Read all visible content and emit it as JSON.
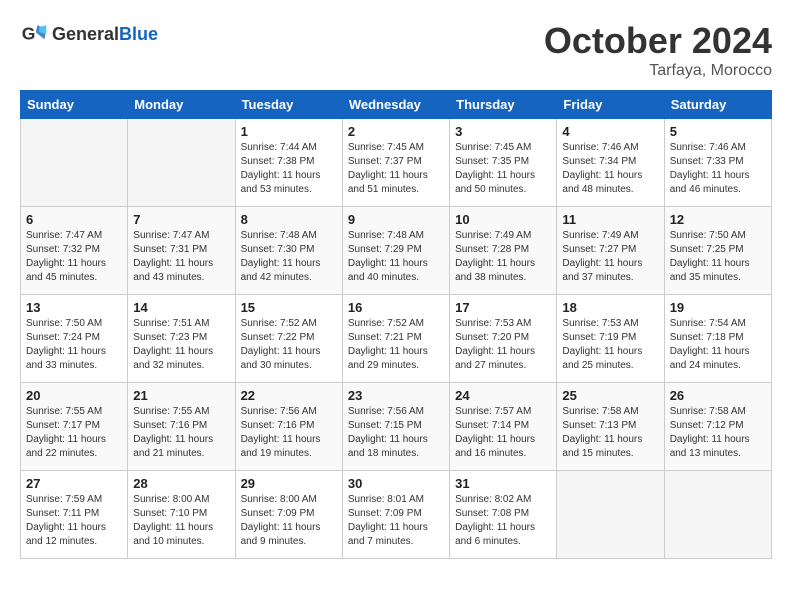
{
  "header": {
    "logo_general": "General",
    "logo_blue": "Blue",
    "month": "October 2024",
    "location": "Tarfaya, Morocco"
  },
  "days_of_week": [
    "Sunday",
    "Monday",
    "Tuesday",
    "Wednesday",
    "Thursday",
    "Friday",
    "Saturday"
  ],
  "weeks": [
    [
      {
        "day": "",
        "empty": true
      },
      {
        "day": "",
        "empty": true
      },
      {
        "day": "1",
        "sunrise": "7:44 AM",
        "sunset": "7:38 PM",
        "daylight": "11 hours and 53 minutes."
      },
      {
        "day": "2",
        "sunrise": "7:45 AM",
        "sunset": "7:37 PM",
        "daylight": "11 hours and 51 minutes."
      },
      {
        "day": "3",
        "sunrise": "7:45 AM",
        "sunset": "7:35 PM",
        "daylight": "11 hours and 50 minutes."
      },
      {
        "day": "4",
        "sunrise": "7:46 AM",
        "sunset": "7:34 PM",
        "daylight": "11 hours and 48 minutes."
      },
      {
        "day": "5",
        "sunrise": "7:46 AM",
        "sunset": "7:33 PM",
        "daylight": "11 hours and 46 minutes."
      }
    ],
    [
      {
        "day": "6",
        "sunrise": "7:47 AM",
        "sunset": "7:32 PM",
        "daylight": "11 hours and 45 minutes."
      },
      {
        "day": "7",
        "sunrise": "7:47 AM",
        "sunset": "7:31 PM",
        "daylight": "11 hours and 43 minutes."
      },
      {
        "day": "8",
        "sunrise": "7:48 AM",
        "sunset": "7:30 PM",
        "daylight": "11 hours and 42 minutes."
      },
      {
        "day": "9",
        "sunrise": "7:48 AM",
        "sunset": "7:29 PM",
        "daylight": "11 hours and 40 minutes."
      },
      {
        "day": "10",
        "sunrise": "7:49 AM",
        "sunset": "7:28 PM",
        "daylight": "11 hours and 38 minutes."
      },
      {
        "day": "11",
        "sunrise": "7:49 AM",
        "sunset": "7:27 PM",
        "daylight": "11 hours and 37 minutes."
      },
      {
        "day": "12",
        "sunrise": "7:50 AM",
        "sunset": "7:25 PM",
        "daylight": "11 hours and 35 minutes."
      }
    ],
    [
      {
        "day": "13",
        "sunrise": "7:50 AM",
        "sunset": "7:24 PM",
        "daylight": "11 hours and 33 minutes."
      },
      {
        "day": "14",
        "sunrise": "7:51 AM",
        "sunset": "7:23 PM",
        "daylight": "11 hours and 32 minutes."
      },
      {
        "day": "15",
        "sunrise": "7:52 AM",
        "sunset": "7:22 PM",
        "daylight": "11 hours and 30 minutes."
      },
      {
        "day": "16",
        "sunrise": "7:52 AM",
        "sunset": "7:21 PM",
        "daylight": "11 hours and 29 minutes."
      },
      {
        "day": "17",
        "sunrise": "7:53 AM",
        "sunset": "7:20 PM",
        "daylight": "11 hours and 27 minutes."
      },
      {
        "day": "18",
        "sunrise": "7:53 AM",
        "sunset": "7:19 PM",
        "daylight": "11 hours and 25 minutes."
      },
      {
        "day": "19",
        "sunrise": "7:54 AM",
        "sunset": "7:18 PM",
        "daylight": "11 hours and 24 minutes."
      }
    ],
    [
      {
        "day": "20",
        "sunrise": "7:55 AM",
        "sunset": "7:17 PM",
        "daylight": "11 hours and 22 minutes."
      },
      {
        "day": "21",
        "sunrise": "7:55 AM",
        "sunset": "7:16 PM",
        "daylight": "11 hours and 21 minutes."
      },
      {
        "day": "22",
        "sunrise": "7:56 AM",
        "sunset": "7:16 PM",
        "daylight": "11 hours and 19 minutes."
      },
      {
        "day": "23",
        "sunrise": "7:56 AM",
        "sunset": "7:15 PM",
        "daylight": "11 hours and 18 minutes."
      },
      {
        "day": "24",
        "sunrise": "7:57 AM",
        "sunset": "7:14 PM",
        "daylight": "11 hours and 16 minutes."
      },
      {
        "day": "25",
        "sunrise": "7:58 AM",
        "sunset": "7:13 PM",
        "daylight": "11 hours and 15 minutes."
      },
      {
        "day": "26",
        "sunrise": "7:58 AM",
        "sunset": "7:12 PM",
        "daylight": "11 hours and 13 minutes."
      }
    ],
    [
      {
        "day": "27",
        "sunrise": "7:59 AM",
        "sunset": "7:11 PM",
        "daylight": "11 hours and 12 minutes."
      },
      {
        "day": "28",
        "sunrise": "8:00 AM",
        "sunset": "7:10 PM",
        "daylight": "11 hours and 10 minutes."
      },
      {
        "day": "29",
        "sunrise": "8:00 AM",
        "sunset": "7:09 PM",
        "daylight": "11 hours and 9 minutes."
      },
      {
        "day": "30",
        "sunrise": "8:01 AM",
        "sunset": "7:09 PM",
        "daylight": "11 hours and 7 minutes."
      },
      {
        "day": "31",
        "sunrise": "8:02 AM",
        "sunset": "7:08 PM",
        "daylight": "11 hours and 6 minutes."
      },
      {
        "day": "",
        "empty": true
      },
      {
        "day": "",
        "empty": true
      }
    ]
  ]
}
